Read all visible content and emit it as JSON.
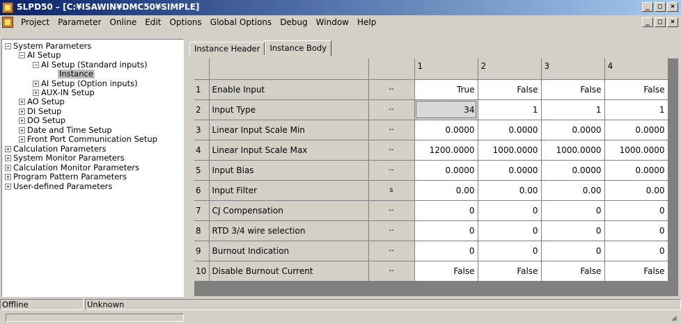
{
  "window": {
    "title": "SLPD50 – [C:¥ISAWIN¥DMC50¥SIMPLE]",
    "minimize_glyph": "_",
    "maximize_glyph": "□",
    "close_glyph": "×",
    "restore_glyph": "ð"
  },
  "menu": {
    "items": [
      "Project",
      "Parameter",
      "Online",
      "Edit",
      "Options",
      "Global Options",
      "Debug",
      "Window",
      "Help"
    ]
  },
  "tree": {
    "items": [
      {
        "label": "System Parameters",
        "toggle": "−"
      },
      {
        "label": "AI Setup",
        "toggle": "−"
      },
      {
        "label": "AI Setup (Standard inputs)",
        "toggle": "−"
      },
      {
        "label": "Instance",
        "toggle": ""
      },
      {
        "label": "AI Setup (Option inputs)",
        "toggle": "+"
      },
      {
        "label": "AUX-IN Setup",
        "toggle": "+"
      },
      {
        "label": "AO Setup",
        "toggle": "+"
      },
      {
        "label": "DI Setup",
        "toggle": "+"
      },
      {
        "label": "DO Setup",
        "toggle": "+"
      },
      {
        "label": "Date and Time Setup",
        "toggle": "+"
      },
      {
        "label": "Front Port Communication Setup",
        "toggle": "+"
      },
      {
        "label": "Calculation Parameters",
        "toggle": "+"
      },
      {
        "label": "System Monitor Parameters",
        "toggle": "+"
      },
      {
        "label": "Calculation Monitor Parameters",
        "toggle": "+"
      },
      {
        "label": "Program Pattern Parameters",
        "toggle": "+"
      },
      {
        "label": "User-defined Parameters",
        "toggle": "+"
      }
    ]
  },
  "tabs": [
    {
      "label": "Instance Header",
      "active": false
    },
    {
      "label": "Instance Body",
      "active": true
    }
  ],
  "grid": {
    "columns": [
      "1",
      "2",
      "3",
      "4"
    ],
    "rows": [
      {
        "num": "1",
        "name": "Enable Input",
        "unit": "--",
        "values": [
          "True",
          "False",
          "False",
          "False"
        ]
      },
      {
        "num": "2",
        "name": "Input Type",
        "unit": "--",
        "values": [
          "34",
          "1",
          "1",
          "1"
        ]
      },
      {
        "num": "3",
        "name": "Linear Input Scale Min",
        "unit": "--",
        "values": [
          "0.0000",
          "0.0000",
          "0.0000",
          "0.0000"
        ]
      },
      {
        "num": "4",
        "name": "Linear Input Scale Max",
        "unit": "--",
        "values": [
          "1200.0000",
          "1000.0000",
          "1000.0000",
          "1000.0000"
        ]
      },
      {
        "num": "5",
        "name": "Input Bias",
        "unit": "--",
        "values": [
          "0.0000",
          "0.0000",
          "0.0000",
          "0.0000"
        ]
      },
      {
        "num": "6",
        "name": "Input Filter",
        "unit": "s",
        "values": [
          "0.00",
          "0.00",
          "0.00",
          "0.00"
        ]
      },
      {
        "num": "7",
        "name": "CJ Compensation",
        "unit": "--",
        "values": [
          "0",
          "0",
          "0",
          "0"
        ]
      },
      {
        "num": "8",
        "name": "RTD 3/4 wire selection",
        "unit": "--",
        "values": [
          "0",
          "0",
          "0",
          "0"
        ]
      },
      {
        "num": "9",
        "name": "Burnout Indication",
        "unit": "--",
        "values": [
          "0",
          "0",
          "0",
          "0"
        ]
      },
      {
        "num": "10",
        "name": "Disable Burnout Current",
        "unit": "--",
        "values": [
          "False",
          "False",
          "False",
          "False"
        ]
      }
    ]
  },
  "status": {
    "connection": "Offline",
    "state": "Unknown"
  }
}
